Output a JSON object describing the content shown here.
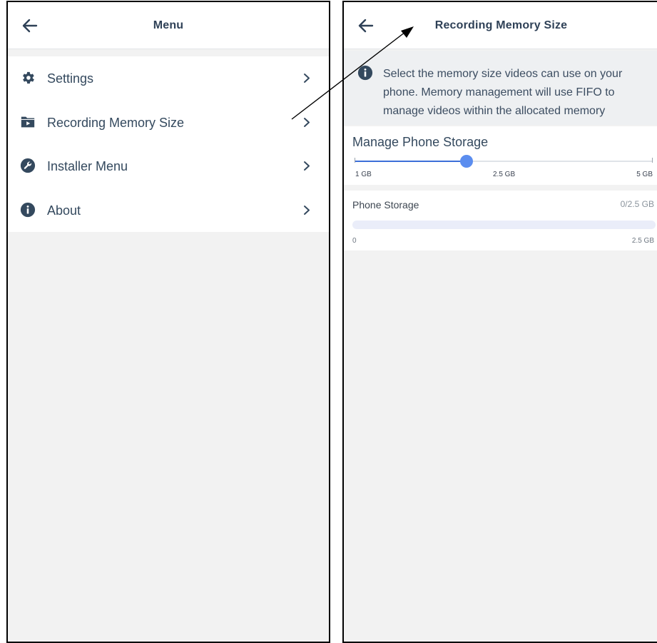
{
  "menu_screen": {
    "title": "Menu",
    "items": [
      {
        "label": "Settings",
        "icon": "gear-icon"
      },
      {
        "label": "Recording Memory Size",
        "icon": "folder-video-icon"
      },
      {
        "label": "Installer Menu",
        "icon": "wrench-icon"
      },
      {
        "label": "About",
        "icon": "info-icon"
      }
    ]
  },
  "memory_screen": {
    "title": "Recording Memory Size",
    "info_text": "Select the memory size videos can use on your phone. Memory management will use FIFO to manage videos within the allocated memory",
    "manage": {
      "title": "Manage Phone Storage",
      "slider": {
        "min_label": "1 GB",
        "mid_label": "2.5 GB",
        "max_label": "5 GB",
        "min": 1,
        "max": 5,
        "value": 2.5
      }
    },
    "storage": {
      "title": "Phone Storage",
      "value_text": "0/2.5 GB",
      "used_fraction": 0,
      "min_label": "0",
      "max_label": "2.5 GB"
    }
  },
  "colors": {
    "accent": "#5b8def",
    "text": "#34495e",
    "background": "#f2f2f2"
  }
}
